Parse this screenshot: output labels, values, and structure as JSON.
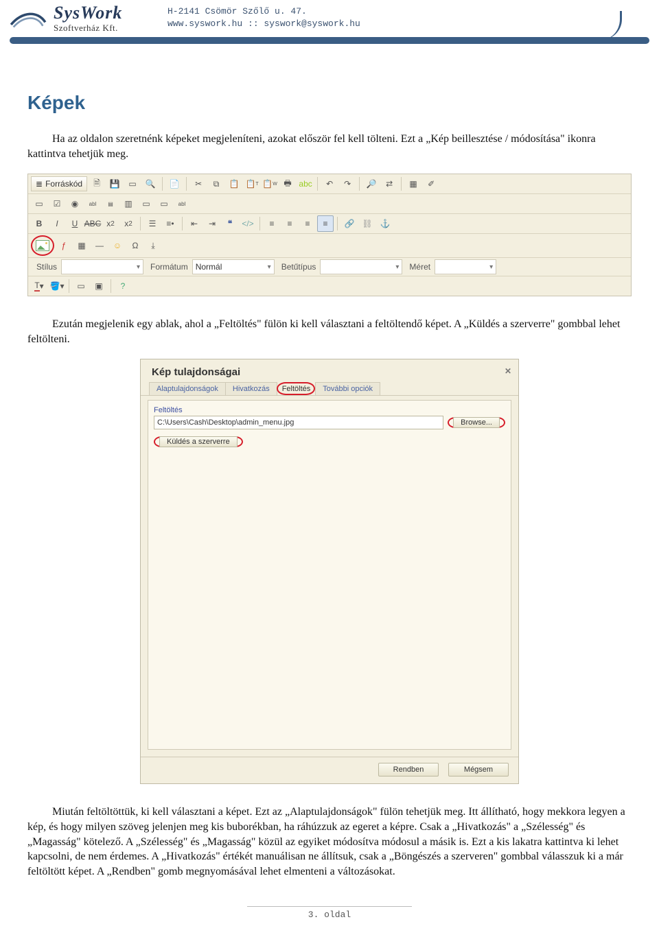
{
  "header": {
    "logo_title": "SysWork",
    "logo_sub": "Szoftverház Kft.",
    "addr_line1": "H-2141 Csömör Szőlő u. 47.",
    "addr_line2": "www.syswork.hu :: syswork@syswork.hu"
  },
  "section_title": "Képek",
  "para1": "Ha az oldalon szeretnénk képeket megjeleníteni, azokat először fel kell tölteni. Ezt a „Kép beillesztése / módosítása\" ikonra kattintva tehetjük meg.",
  "para2": "Ezután megjelenik egy ablak, ahol a „Feltöltés\" fülön ki kell választani a feltöltendő képet. A „Küldés a szerverre\" gombbal lehet feltölteni.",
  "para3": "Miután feltöltöttük, ki kell választani a képet. Ezt az „Alaptulajdonságok\" fülön tehetjük meg. Itt állítható, hogy mekkora legyen a kép, és hogy milyen szöveg jelenjen meg kis buborékban, ha ráhúzzuk az egeret a képre. Csak a „Hivatkozás\" a „Szélesség\" és „Magasság\" kötelező. A „Szélesség\" és „Magasság\" közül az egyiket módosítva módosul a másik is. Ezt a kis lakatra kattintva ki lehet kapcsolni, de nem érdemes. A „Hivatkozás\" értékét manuálisan ne állítsuk, csak a „Böngészés a szerveren\" gombbal válasszuk ki a már feltöltött képet. A „Rendben\" gomb megnyomásával lehet elmenteni a változásokat.",
  "editor": {
    "source_button": "Forráskód",
    "style_label": "Stílus",
    "style_value": "",
    "format_label": "Formátum",
    "format_value": "Normál",
    "font_label": "Betűtípus",
    "font_value": "",
    "size_label": "Méret",
    "size_value": ""
  },
  "dialog": {
    "title": "Kép tulajdonságai",
    "tabs": [
      "Alaptulajdonságok",
      "Hivatkozás",
      "Feltöltés",
      "További opciók"
    ],
    "active_tab_index": 2,
    "upload_label": "Feltöltés",
    "path_value": "C:\\Users\\Cash\\Desktop\\admin_menu.jpg",
    "browse_label": "Browse...",
    "send_label": "Küldés a szerverre",
    "ok_label": "Rendben",
    "cancel_label": "Mégsem"
  },
  "footer": {
    "page": "3. oldal"
  }
}
